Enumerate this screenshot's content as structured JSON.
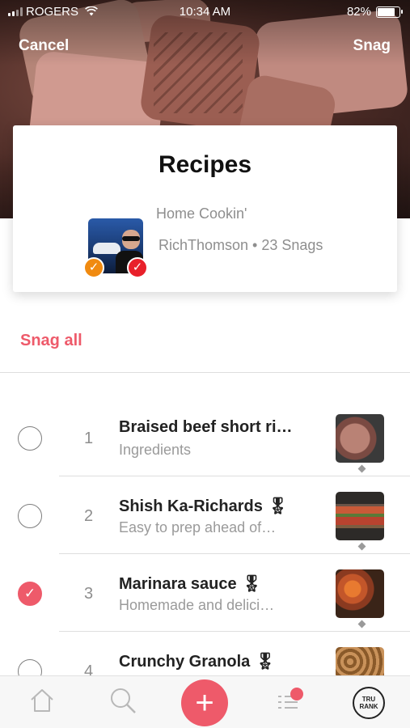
{
  "status_bar": {
    "carrier": "ROGERS",
    "time": "10:34 AM",
    "battery": "82%",
    "battery_level": 0.82
  },
  "header": {
    "cancel_label": "Cancel",
    "snag_label": "Snag"
  },
  "collection": {
    "title": "Recipes",
    "subtitle": "Home Cookin'",
    "author_line": "RichThomson • 23 Snags",
    "badge_check": "✓"
  },
  "snag_all_label": "Snag all",
  "recipes": [
    {
      "number": "1",
      "title": "Braised beef short ri…",
      "medal": "",
      "description": "Ingredients",
      "selected": false
    },
    {
      "number": "2",
      "title": "Shish Ka-Richards",
      "medal": "🎖",
      "description": "Easy to prep ahead of…",
      "selected": false
    },
    {
      "number": "3",
      "title": "Marinara sauce",
      "medal": "🎖",
      "description": "Homemade and delici…",
      "selected": true
    },
    {
      "number": "4",
      "title": "Crunchy Granola",
      "medal": "🎖",
      "description": "",
      "selected": false
    }
  ],
  "tab_bar": {
    "add_label": "+",
    "rank_line1": "TRU",
    "rank_line2": "RANK",
    "icons": [
      "home-icon",
      "search-icon",
      "add-icon",
      "feed-icon",
      "true-rank-icon"
    ]
  },
  "colors": {
    "accent": "#ee5a6a",
    "badge_orange": "#f08a10",
    "badge_red": "#e8202a"
  }
}
